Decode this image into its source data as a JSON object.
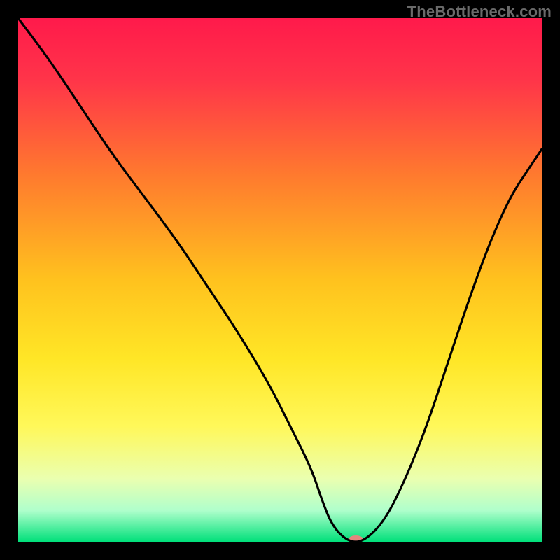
{
  "watermark": "TheBottleneck.com",
  "chart_data": {
    "type": "line",
    "title": "",
    "xlabel": "",
    "ylabel": "",
    "xlim": [
      0,
      100
    ],
    "ylim": [
      0,
      100
    ],
    "grid": false,
    "legend": false,
    "gradient_stops": [
      {
        "offset": 0.0,
        "color": "#ff1a4b"
      },
      {
        "offset": 0.12,
        "color": "#ff3549"
      },
      {
        "offset": 0.3,
        "color": "#ff7a2e"
      },
      {
        "offset": 0.5,
        "color": "#ffc21e"
      },
      {
        "offset": 0.65,
        "color": "#ffe626"
      },
      {
        "offset": 0.78,
        "color": "#fff85a"
      },
      {
        "offset": 0.88,
        "color": "#eaffb0"
      },
      {
        "offset": 0.94,
        "color": "#b0ffcc"
      },
      {
        "offset": 1.0,
        "color": "#00e07a"
      }
    ],
    "series": [
      {
        "name": "bottleneck-curve",
        "x": [
          0,
          6,
          12,
          18,
          24,
          30,
          36,
          42,
          48,
          52,
          56,
          58,
          60,
          63,
          66,
          70,
          74,
          78,
          82,
          86,
          90,
          94,
          98,
          100
        ],
        "y": [
          100,
          92,
          83,
          74,
          66,
          58,
          49,
          40,
          30,
          22,
          14,
          8,
          3,
          0,
          0,
          4,
          12,
          22,
          34,
          46,
          57,
          66,
          72,
          75
        ]
      }
    ],
    "marker": {
      "name": "optimal-point",
      "x": 64.5,
      "y": 0,
      "color": "#e4867e",
      "rx": 10,
      "ry": 5
    }
  }
}
